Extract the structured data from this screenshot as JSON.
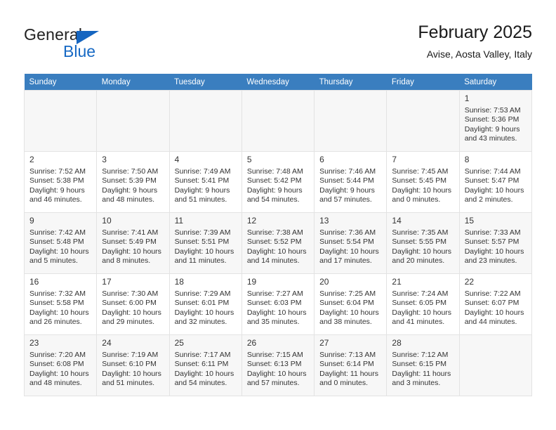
{
  "brand": {
    "name_part1": "General",
    "name_part2": "Blue",
    "triangle_color": "#1565c0",
    "blue_color": "#1769c4"
  },
  "header": {
    "title": "February 2025",
    "subtitle": "Avise, Aosta Valley, Italy"
  },
  "theme": {
    "header_row_bg": "#3a7ebf",
    "header_row_text": "#ffffff",
    "shaded_row_bg": "#f7f7f7",
    "cell_border": "#e3e3e3"
  },
  "weekdays": [
    "Sunday",
    "Monday",
    "Tuesday",
    "Wednesday",
    "Thursday",
    "Friday",
    "Saturday"
  ],
  "weeks": [
    {
      "shaded": true,
      "days": [
        {
          "num": "",
          "info": ""
        },
        {
          "num": "",
          "info": ""
        },
        {
          "num": "",
          "info": ""
        },
        {
          "num": "",
          "info": ""
        },
        {
          "num": "",
          "info": ""
        },
        {
          "num": "",
          "info": ""
        },
        {
          "num": "1",
          "info": "Sunrise: 7:53 AM\nSunset: 5:36 PM\nDaylight: 9 hours\nand 43 minutes."
        }
      ]
    },
    {
      "shaded": false,
      "days": [
        {
          "num": "2",
          "info": "Sunrise: 7:52 AM\nSunset: 5:38 PM\nDaylight: 9 hours\nand 46 minutes."
        },
        {
          "num": "3",
          "info": "Sunrise: 7:50 AM\nSunset: 5:39 PM\nDaylight: 9 hours\nand 48 minutes."
        },
        {
          "num": "4",
          "info": "Sunrise: 7:49 AM\nSunset: 5:41 PM\nDaylight: 9 hours\nand 51 minutes."
        },
        {
          "num": "5",
          "info": "Sunrise: 7:48 AM\nSunset: 5:42 PM\nDaylight: 9 hours\nand 54 minutes."
        },
        {
          "num": "6",
          "info": "Sunrise: 7:46 AM\nSunset: 5:44 PM\nDaylight: 9 hours\nand 57 minutes."
        },
        {
          "num": "7",
          "info": "Sunrise: 7:45 AM\nSunset: 5:45 PM\nDaylight: 10 hours\nand 0 minutes."
        },
        {
          "num": "8",
          "info": "Sunrise: 7:44 AM\nSunset: 5:47 PM\nDaylight: 10 hours\nand 2 minutes."
        }
      ]
    },
    {
      "shaded": true,
      "days": [
        {
          "num": "9",
          "info": "Sunrise: 7:42 AM\nSunset: 5:48 PM\nDaylight: 10 hours\nand 5 minutes."
        },
        {
          "num": "10",
          "info": "Sunrise: 7:41 AM\nSunset: 5:49 PM\nDaylight: 10 hours\nand 8 minutes."
        },
        {
          "num": "11",
          "info": "Sunrise: 7:39 AM\nSunset: 5:51 PM\nDaylight: 10 hours\nand 11 minutes."
        },
        {
          "num": "12",
          "info": "Sunrise: 7:38 AM\nSunset: 5:52 PM\nDaylight: 10 hours\nand 14 minutes."
        },
        {
          "num": "13",
          "info": "Sunrise: 7:36 AM\nSunset: 5:54 PM\nDaylight: 10 hours\nand 17 minutes."
        },
        {
          "num": "14",
          "info": "Sunrise: 7:35 AM\nSunset: 5:55 PM\nDaylight: 10 hours\nand 20 minutes."
        },
        {
          "num": "15",
          "info": "Sunrise: 7:33 AM\nSunset: 5:57 PM\nDaylight: 10 hours\nand 23 minutes."
        }
      ]
    },
    {
      "shaded": false,
      "days": [
        {
          "num": "16",
          "info": "Sunrise: 7:32 AM\nSunset: 5:58 PM\nDaylight: 10 hours\nand 26 minutes."
        },
        {
          "num": "17",
          "info": "Sunrise: 7:30 AM\nSunset: 6:00 PM\nDaylight: 10 hours\nand 29 minutes."
        },
        {
          "num": "18",
          "info": "Sunrise: 7:29 AM\nSunset: 6:01 PM\nDaylight: 10 hours\nand 32 minutes."
        },
        {
          "num": "19",
          "info": "Sunrise: 7:27 AM\nSunset: 6:03 PM\nDaylight: 10 hours\nand 35 minutes."
        },
        {
          "num": "20",
          "info": "Sunrise: 7:25 AM\nSunset: 6:04 PM\nDaylight: 10 hours\nand 38 minutes."
        },
        {
          "num": "21",
          "info": "Sunrise: 7:24 AM\nSunset: 6:05 PM\nDaylight: 10 hours\nand 41 minutes."
        },
        {
          "num": "22",
          "info": "Sunrise: 7:22 AM\nSunset: 6:07 PM\nDaylight: 10 hours\nand 44 minutes."
        }
      ]
    },
    {
      "shaded": true,
      "days": [
        {
          "num": "23",
          "info": "Sunrise: 7:20 AM\nSunset: 6:08 PM\nDaylight: 10 hours\nand 48 minutes."
        },
        {
          "num": "24",
          "info": "Sunrise: 7:19 AM\nSunset: 6:10 PM\nDaylight: 10 hours\nand 51 minutes."
        },
        {
          "num": "25",
          "info": "Sunrise: 7:17 AM\nSunset: 6:11 PM\nDaylight: 10 hours\nand 54 minutes."
        },
        {
          "num": "26",
          "info": "Sunrise: 7:15 AM\nSunset: 6:13 PM\nDaylight: 10 hours\nand 57 minutes."
        },
        {
          "num": "27",
          "info": "Sunrise: 7:13 AM\nSunset: 6:14 PM\nDaylight: 11 hours\nand 0 minutes."
        },
        {
          "num": "28",
          "info": "Sunrise: 7:12 AM\nSunset: 6:15 PM\nDaylight: 11 hours\nand 3 minutes."
        },
        {
          "num": "",
          "info": ""
        }
      ]
    }
  ]
}
